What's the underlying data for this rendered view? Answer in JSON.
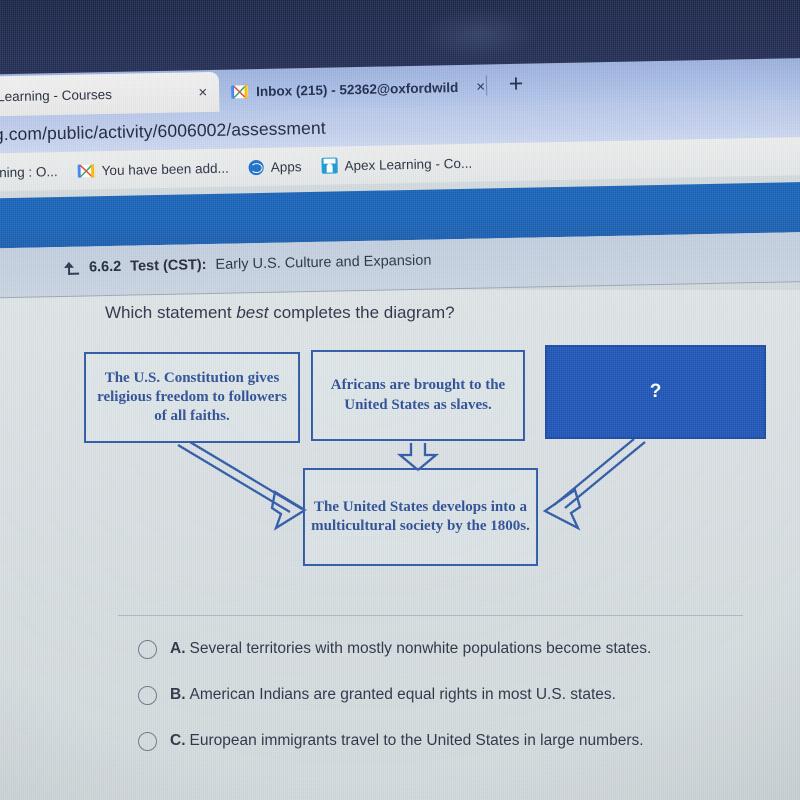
{
  "browser": {
    "tabs": [
      {
        "title": "ex Learning - Courses",
        "close_label": "×",
        "icon": "none",
        "active": true
      },
      {
        "title": "Inbox (215) - 52362@oxfordwild",
        "close_label": "×",
        "icon": "gmail-icon",
        "active": false
      }
    ],
    "new_tab_label": "+",
    "url": "g.com/public/activity/6006002/assessment",
    "bookmarks": [
      {
        "label": "rning : O...",
        "icon": "none"
      },
      {
        "label": "You have been add...",
        "icon": "gmail-icon"
      },
      {
        "label": "Apps",
        "icon": "globe-icon"
      },
      {
        "label": "Apex Learning - Co...",
        "icon": "apex-icon"
      }
    ]
  },
  "lesson_bar": {
    "back_icon": "return-arrow-icon",
    "number": "6.6.2",
    "type": "Test (CST):",
    "name": "Early U.S. Culture and Expansion"
  },
  "question": {
    "prompt_before": "Which statement ",
    "prompt_emphasis": "best",
    "prompt_after": " completes the diagram?",
    "choices": [
      {
        "letter": "A.",
        "text": "Several territories with mostly nonwhite populations become states.",
        "selected": false
      },
      {
        "letter": "B.",
        "text": "American Indians are granted equal rights in most U.S. states.",
        "selected": false
      },
      {
        "letter": "C.",
        "text": "European immigrants travel to the United States in large numbers.",
        "selected": false
      }
    ]
  },
  "diagram": {
    "box1": "The U.S. Constitution gives religious freedom to followers of all faiths.",
    "box2": "Africans are brought to the United States as slaves.",
    "box_unknown": "?",
    "box_result": "The United States develops into a multicultural society by the 1800s.",
    "arrows": [
      {
        "name": "arrow-box1-to-result",
        "direction": "diagonal-down-right"
      },
      {
        "name": "arrow-box2-to-result",
        "direction": "down"
      },
      {
        "name": "arrow-unknown-to-result",
        "direction": "diagonal-down-left"
      }
    ]
  },
  "colors": {
    "app_band_blue": "#1963b8",
    "diagram_line_blue": "#2f5aa8",
    "diagram_text_blue": "#2d4f97",
    "unknown_box_fill": "#1f56b8",
    "page_background": "#dbe2e5",
    "body_text": "#2b3346"
  }
}
